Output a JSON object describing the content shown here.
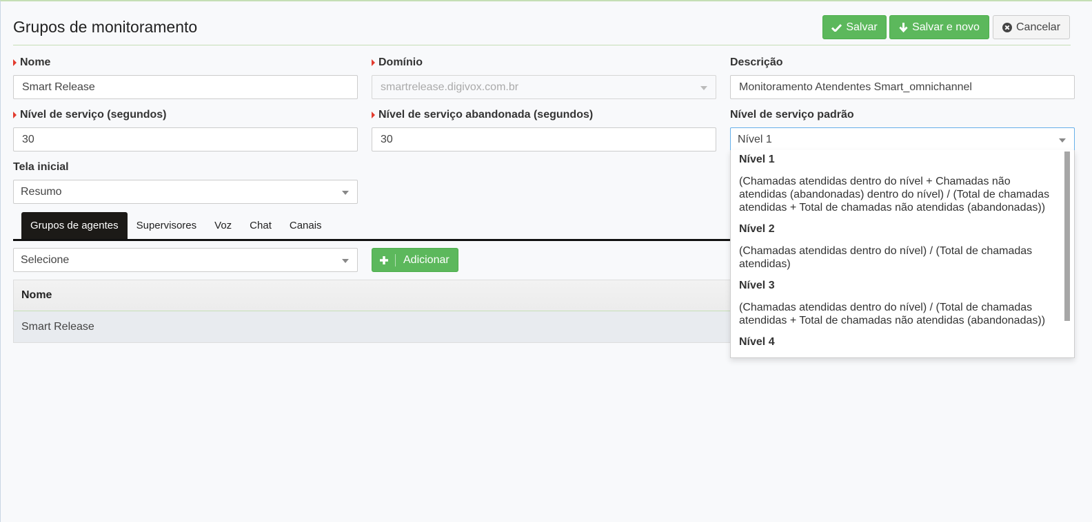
{
  "header": {
    "title": "Grupos de monitoramento",
    "save_label": "Salvar",
    "save_new_label": "Salvar e novo",
    "cancel_label": "Cancelar"
  },
  "form": {
    "nome": {
      "label": "Nome",
      "value": "Smart Release"
    },
    "dominio": {
      "label": "Domínio",
      "value": "smartrelease.digivox.com.br"
    },
    "descricao": {
      "label": "Descrição",
      "value": "Monitoramento Atendentes Smart_omnichannel"
    },
    "nivel_servico": {
      "label": "Nível de serviço (segundos)",
      "value": "30"
    },
    "nivel_abandonada": {
      "label": "Nível de serviço abandonada (segundos)",
      "value": "30"
    },
    "nivel_padrao": {
      "label": "Nível de serviço padrão",
      "value": "Nível 1"
    },
    "tela_inicial": {
      "label": "Tela inicial",
      "value": "Resumo"
    }
  },
  "tabs": [
    {
      "label": "Grupos de agentes",
      "active": true
    },
    {
      "label": "Supervisores",
      "active": false
    },
    {
      "label": "Voz",
      "active": false
    },
    {
      "label": "Chat",
      "active": false
    },
    {
      "label": "Canais",
      "active": false
    }
  ],
  "agent_groups": {
    "select_value": "Selecione",
    "add_label": "Adicionar",
    "table_header": "Nome",
    "rows": [
      "Smart Release"
    ]
  },
  "dropdown_options": [
    {
      "title": "Nível 1",
      "desc": "(Chamadas atendidas dentro do nível + Chamadas não atendidas (abandonadas) dentro do nível) / (Total de chamadas atendidas + Total de chamadas não atendidas (abandonadas))"
    },
    {
      "title": "Nível 2",
      "desc": "(Chamadas atendidas dentro do nível) / (Total de chamadas atendidas)"
    },
    {
      "title": "Nível 3",
      "desc": "(Chamadas atendidas dentro do nível) / (Total de chamadas atendidas + Total de chamadas não atendidas (abandonadas))"
    },
    {
      "title": "Nível 4",
      "desc": ""
    }
  ],
  "colors": {
    "accent_green": "#5cb85c",
    "required_marker": "#e23b2e",
    "active_tab": "#1c1a17"
  }
}
